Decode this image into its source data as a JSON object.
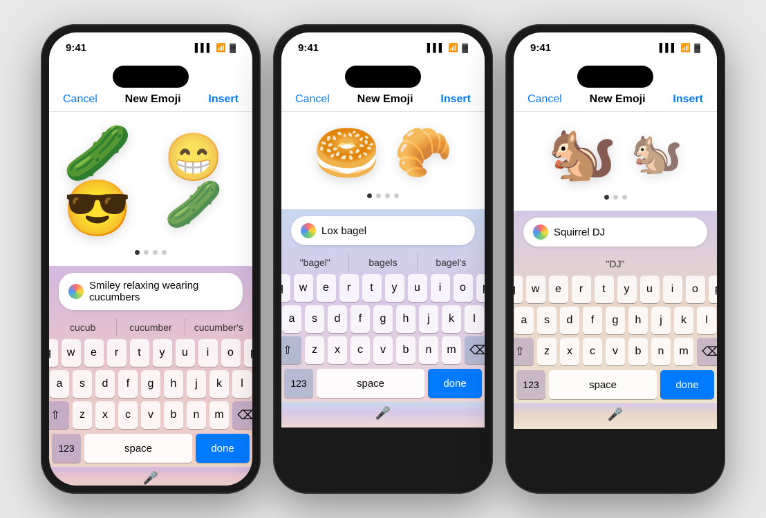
{
  "phones": [
    {
      "id": "phone-1",
      "status": {
        "time": "9:41",
        "signal": "▌▌▌",
        "wifi": "wifi",
        "battery": "battery"
      },
      "nav": {
        "cancel": "Cancel",
        "title": "New Emoji",
        "insert": "Insert"
      },
      "emojis": [
        "🥒😎",
        "😁🥒"
      ],
      "emoji_primary": "😎",
      "emoji_secondary": "😁",
      "prompt": "Smiley relaxing wearing cucumbers",
      "autocomplete": [
        "cucub",
        "cucumber",
        "cucumber's"
      ],
      "keyboard": {
        "rows": [
          [
            "q",
            "w",
            "e",
            "r",
            "t",
            "y",
            "u",
            "i",
            "o",
            "p"
          ],
          [
            "a",
            "s",
            "d",
            "f",
            "g",
            "h",
            "j",
            "k",
            "l"
          ],
          [
            "z",
            "x",
            "c",
            "v",
            "b",
            "n",
            "m"
          ]
        ],
        "bottom": [
          "123",
          "space",
          "done"
        ]
      }
    },
    {
      "id": "phone-2",
      "status": {
        "time": "9:41",
        "signal": "▌▌▌",
        "wifi": "wifi",
        "battery": "battery"
      },
      "nav": {
        "cancel": "Cancel",
        "title": "New Emoji",
        "insert": "Insert"
      },
      "emoji_primary": "🥯",
      "emoji_secondary": "🥐",
      "prompt": "Lox bagel",
      "autocomplete": [
        "\"bagel\"",
        "bagels",
        "bagel's"
      ],
      "keyboard": {
        "rows": [
          [
            "q",
            "w",
            "e",
            "r",
            "t",
            "y",
            "u",
            "i",
            "o",
            "p"
          ],
          [
            "a",
            "s",
            "d",
            "f",
            "g",
            "h",
            "j",
            "k",
            "l"
          ],
          [
            "z",
            "x",
            "c",
            "v",
            "b",
            "n",
            "m"
          ]
        ],
        "bottom": [
          "123",
          "space",
          "done"
        ]
      }
    },
    {
      "id": "phone-3",
      "status": {
        "time": "9:41",
        "signal": "▌▌▌",
        "wifi": "wifi",
        "battery": "battery"
      },
      "nav": {
        "cancel": "Cancel",
        "title": "New Emoji",
        "insert": "Insert"
      },
      "emoji_primary": "🐿️",
      "emoji_secondary": "🐿",
      "prompt": "Squirrel DJ",
      "autocomplete": [
        "\"DJ\""
      ],
      "keyboard": {
        "rows": [
          [
            "q",
            "w",
            "e",
            "r",
            "t",
            "y",
            "u",
            "i",
            "o",
            "p"
          ],
          [
            "a",
            "s",
            "d",
            "f",
            "g",
            "h",
            "j",
            "k",
            "l"
          ],
          [
            "z",
            "x",
            "c",
            "v",
            "b",
            "n",
            "m"
          ]
        ],
        "bottom": [
          "123",
          "space",
          "done"
        ]
      }
    }
  ],
  "labels": {
    "cancel": "Cancel",
    "insert": "Insert",
    "new_emoji": "New Emoji",
    "space": "space",
    "done": "done",
    "num": "123",
    "mic": "🎤"
  }
}
